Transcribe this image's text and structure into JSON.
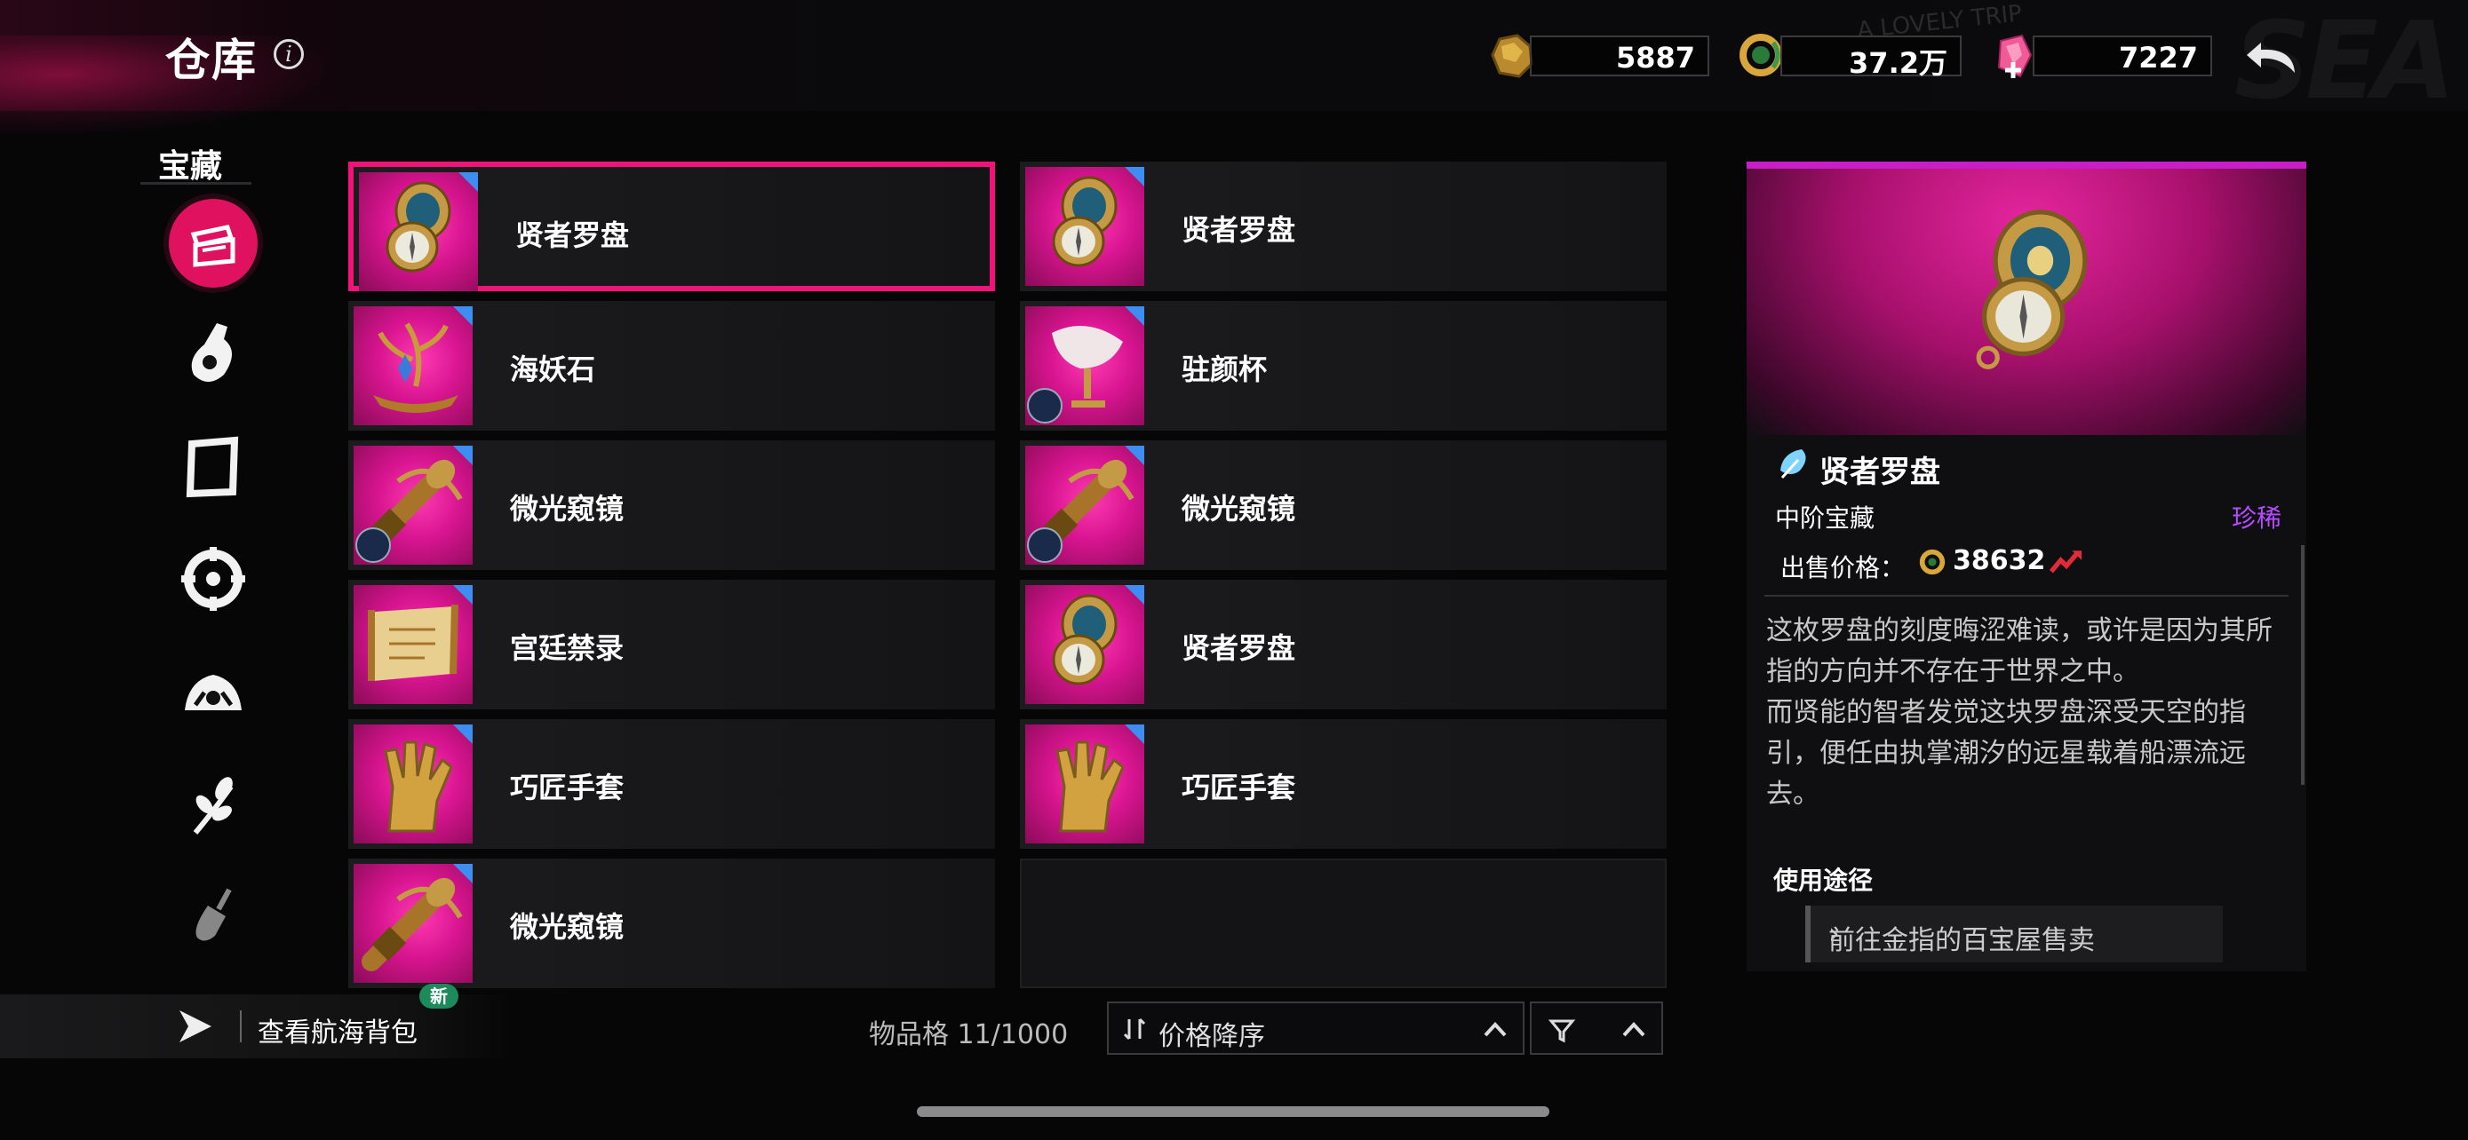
{
  "header": {
    "title": "仓库",
    "currencies": [
      {
        "icon": "gold-ore-icon",
        "value": "5887"
      },
      {
        "icon": "serpent-ring-coin-icon",
        "value": "37.2万"
      },
      {
        "icon": "pink-gem-add-icon",
        "value": "7227"
      }
    ]
  },
  "sidebar": {
    "label": "宝藏",
    "items": [
      {
        "icon": "treasure-chest-icon",
        "active": true
      },
      {
        "icon": "potion-bottle-icon"
      },
      {
        "icon": "scroll-frame-icon"
      },
      {
        "icon": "ship-wheel-icon"
      },
      {
        "icon": "crown-helm-icon"
      },
      {
        "icon": "herb-branch-icon"
      },
      {
        "icon": "shovel-icon"
      }
    ]
  },
  "items": [
    {
      "name": "贤者罗盘",
      "art": "compass",
      "selected": true
    },
    {
      "name": "贤者罗盘",
      "art": "compass"
    },
    {
      "name": "海妖石",
      "art": "siren-stone"
    },
    {
      "name": "驻颜杯",
      "art": "shell-cup",
      "badge": true
    },
    {
      "name": "微光窥镜",
      "art": "spyglass",
      "badge": true
    },
    {
      "name": "微光窥镜",
      "art": "spyglass",
      "badge": true
    },
    {
      "name": "宫廷禁录",
      "art": "scroll"
    },
    {
      "name": "贤者罗盘",
      "art": "compass"
    },
    {
      "name": "巧匠手套",
      "art": "glove"
    },
    {
      "name": "巧匠手套",
      "art": "glove"
    },
    {
      "name": "微光窥镜",
      "art": "spyglass"
    }
  ],
  "detail": {
    "name": "贤者罗盘",
    "tier": "中阶宝藏",
    "rarity": "珍稀",
    "price_label": "出售价格：",
    "price_value": "38632",
    "description": "这枚罗盘的刻度晦涩难读，或许是因为其所指的方向并不存在于世界之中。\n而贤能的智者发觉这块罗盘深受天空的指引，便任由执掌潮汐的远星载着船漂流远去。",
    "usage_title": "使用途径",
    "usage_button": "前往金指的百宝屋售卖"
  },
  "footer": {
    "backpack_label": "查看航海背包",
    "new_badge": "新",
    "slot_count": "物品格 11/1000",
    "sort_label": "价格降序"
  },
  "colors": {
    "accent": "#f01478",
    "rarity": "#b54cff",
    "card_bg": "#d7148f"
  }
}
